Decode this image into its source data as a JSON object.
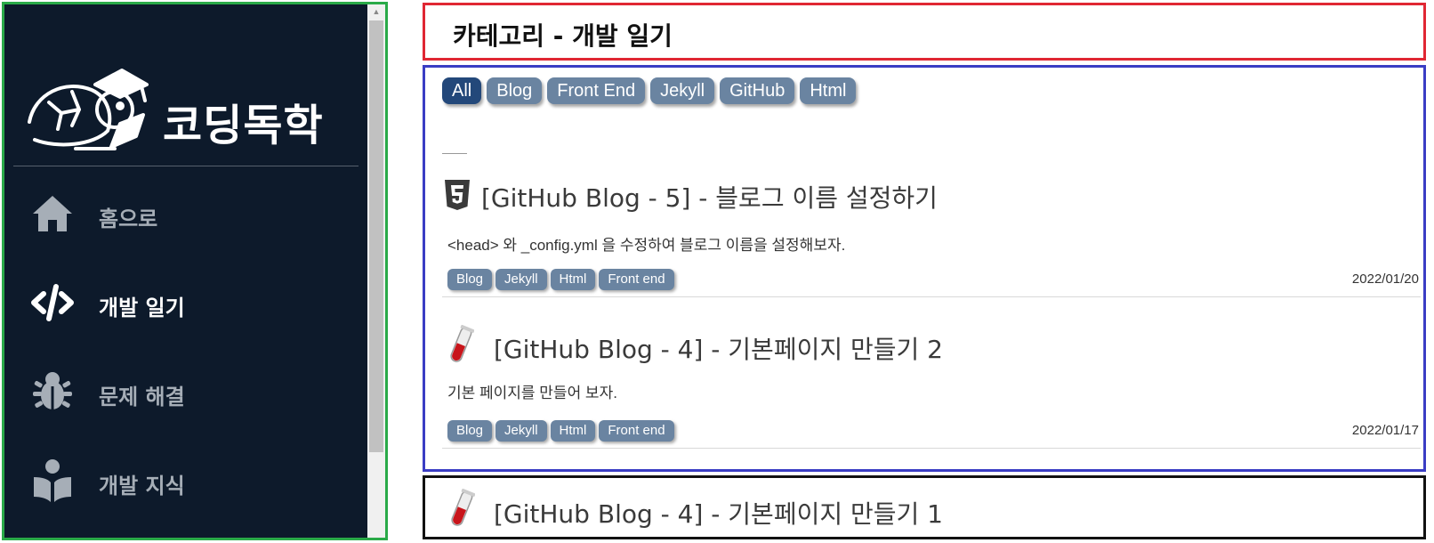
{
  "sidebar": {
    "logo_text": "코딩독학",
    "items": [
      {
        "label": "홈으로",
        "icon": "home-icon",
        "active": false
      },
      {
        "label": "개발 일기",
        "icon": "code-icon",
        "active": true
      },
      {
        "label": "문제 해결",
        "icon": "bug-icon",
        "active": false
      },
      {
        "label": "개발 지식",
        "icon": "book-reader-icon",
        "active": false
      }
    ]
  },
  "header": {
    "title": "카테고리 - 개발 일기"
  },
  "filters": [
    "All",
    "Blog",
    "Front End",
    "Jekyll",
    "GitHub",
    "Html"
  ],
  "posts": [
    {
      "icon": "html5-icon",
      "title": "[GitHub Blog - 5] - 블로그 이름 설정하기",
      "description": "<head> 와 _config.yml 을 수정하여 블로그 이름을 설정해보자.",
      "tags": [
        "Blog",
        "Jekyll",
        "Html",
        "Front end"
      ],
      "date": "2022/01/20"
    },
    {
      "icon": "test-tube-icon",
      "title": "[GitHub Blog - 4] - 기본페이지 만들기 2",
      "description": "기본 페이지를 만들어 보자.",
      "tags": [
        "Blog",
        "Jekyll",
        "Html",
        "Front end"
      ],
      "date": "2022/01/17"
    }
  ],
  "next_post": {
    "icon": "test-tube-icon",
    "title": "[GitHub Blog - 4] - 기본페이지 만들기 1"
  },
  "colors": {
    "sidebar_bg": "#0d1a2b",
    "chip": "#6a84a1",
    "chip_active": "#23487a",
    "outline_sidebar": "#2aaa48",
    "outline_header": "#e02733",
    "outline_main": "#3a3dc4",
    "outline_next": "#111111"
  }
}
